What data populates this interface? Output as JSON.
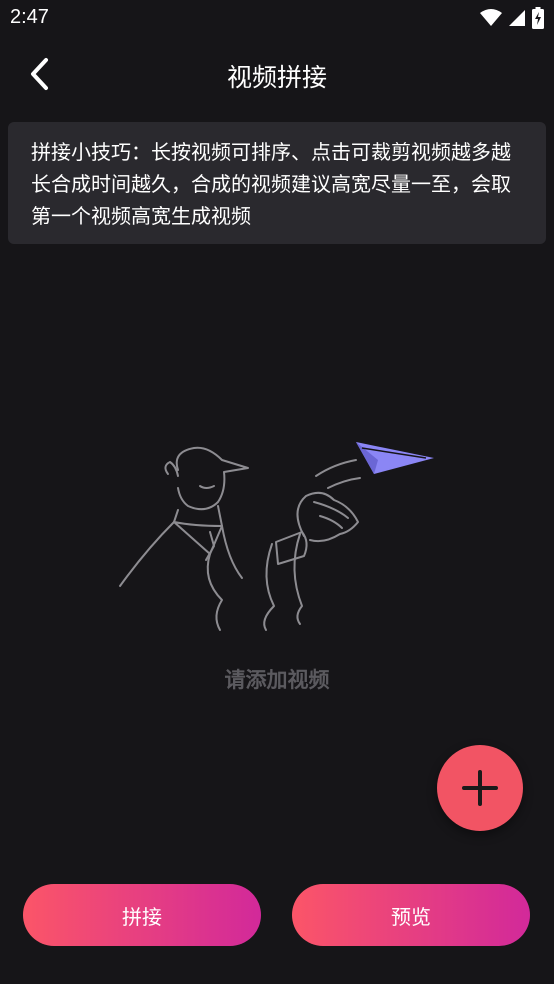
{
  "status_bar": {
    "time": "2:47"
  },
  "header": {
    "title": "视频拼接"
  },
  "tip": {
    "text": "拼接小技巧：长按视频可排序、点击可裁剪视频越多越长合成时间越久，合成的视频建议高宽尽量一至，会取第一个视频高宽生成视频"
  },
  "empty_state": {
    "label": "请添加视频"
  },
  "actions": {
    "splice_label": "拼接",
    "preview_label": "预览"
  },
  "colors": {
    "accent": "#f25464",
    "gradient_start": "#fb5568",
    "gradient_end": "#d2299a",
    "background": "#161518",
    "tip_background": "#2a292e",
    "plane": "#8b86f5"
  }
}
